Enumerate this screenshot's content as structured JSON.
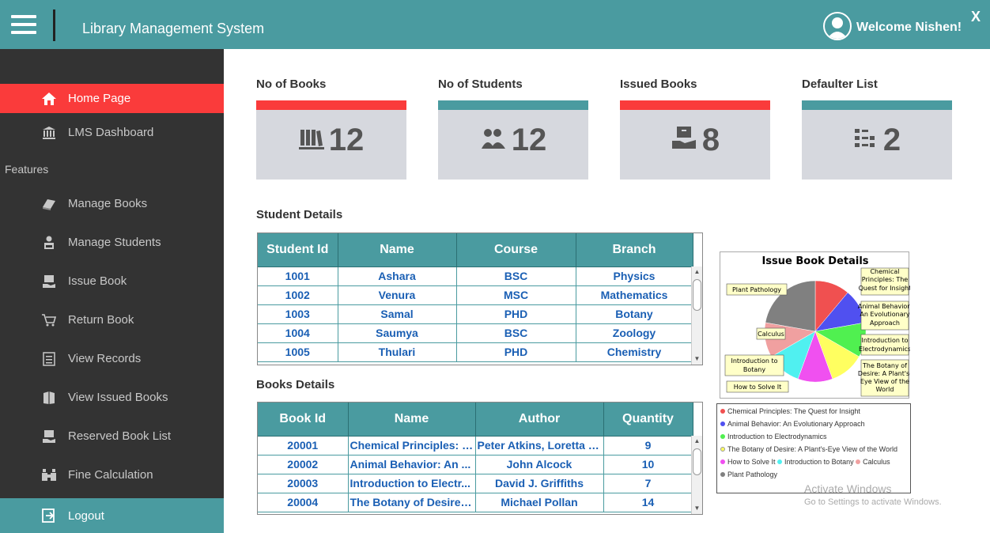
{
  "titlebar": {
    "app_title": "Library Management System",
    "welcome": "Welcome Nishen!",
    "close": "X"
  },
  "sidebar": {
    "items": [
      {
        "label": "Home Page",
        "icon": "home-icon"
      },
      {
        "label": "LMS Dashboard",
        "icon": "bank-icon"
      },
      {
        "label": "Manage Books",
        "icon": "book-icon"
      },
      {
        "label": "Manage Students",
        "icon": "student-icon"
      },
      {
        "label": "Issue Book",
        "icon": "issue-book-icon"
      },
      {
        "label": "Return Book",
        "icon": "cart-return-icon"
      },
      {
        "label": "View Records",
        "icon": "records-icon"
      },
      {
        "label": "View Issued Books",
        "icon": "issued-books-icon"
      },
      {
        "label": "Reserved Book List",
        "icon": "reserved-icon"
      },
      {
        "label": "Fine Calculation",
        "icon": "fine-icon"
      }
    ],
    "section_label": "Features",
    "logout": "Logout"
  },
  "cards": [
    {
      "title": "No of Books",
      "value": "12",
      "color": "#fa3b3b",
      "icon": "books-icon"
    },
    {
      "title": "No of Students",
      "value": "12",
      "color": "#4a9ba0",
      "icon": "students-icon"
    },
    {
      "title": "Issued Books",
      "value": "8",
      "color": "#fa3b3b",
      "icon": "issued-icon"
    },
    {
      "title": "Defaulter List",
      "value": "2",
      "color": "#4a9ba0",
      "icon": "list-icon"
    }
  ],
  "student_details": {
    "title": "Student Details",
    "headers": [
      "Student Id",
      "Name",
      "Course",
      "Branch"
    ],
    "rows": [
      [
        "1001",
        "Ashara",
        "BSC",
        "Physics"
      ],
      [
        "1002",
        "Venura",
        "MSC",
        "Mathematics"
      ],
      [
        "1003",
        "Samal",
        "PHD",
        "Botany"
      ],
      [
        "1004",
        "Saumya",
        "BSC",
        "Zoology"
      ],
      [
        "1005",
        "Thulari",
        "PHD",
        "Chemistry"
      ]
    ]
  },
  "books_details": {
    "title": "Books Details",
    "headers": [
      "Book Id",
      "Name",
      "Author",
      "Quantity"
    ],
    "rows": [
      [
        "20001",
        "Chemical Principles: T...",
        "Peter Atkins, Loretta J...",
        "9"
      ],
      [
        "20002",
        "Animal Behavior: An ...",
        "John Alcock",
        "10"
      ],
      [
        "20003",
        "Introduction to Electr...",
        "David J. Griffiths",
        "7"
      ],
      [
        "20004",
        "The Botany of Desire:...",
        "Michael Pollan",
        "14"
      ]
    ]
  },
  "chart_data": {
    "type": "pie",
    "title": "Issue Book Details",
    "slices": [
      {
        "label": "Chemical Principles: The Quest for Insight",
        "value": 1,
        "color": "#f05050"
      },
      {
        "label": "Animal Behavior: An Evolutionary Approach",
        "value": 1,
        "color": "#5050f0"
      },
      {
        "label": "Introduction to Electrodynamics",
        "value": 1,
        "color": "#50f050"
      },
      {
        "label": "The Botany of Desire: A Plant's-Eye View of the World",
        "value": 1,
        "color": "#ffff60"
      },
      {
        "label": "How to Solve It",
        "value": 1,
        "color": "#f050f0"
      },
      {
        "label": "Introduction to Botany",
        "value": 1,
        "color": "#50f0f0"
      },
      {
        "label": "Calculus",
        "value": 1,
        "color": "#f0a0a0"
      },
      {
        "label": "Plant Pathology",
        "value": 2,
        "color": "#808080"
      }
    ],
    "legend_placement": "bottom"
  },
  "watermark": {
    "line1": "Activate Windows",
    "line2": "Go to Settings to activate Windows."
  }
}
